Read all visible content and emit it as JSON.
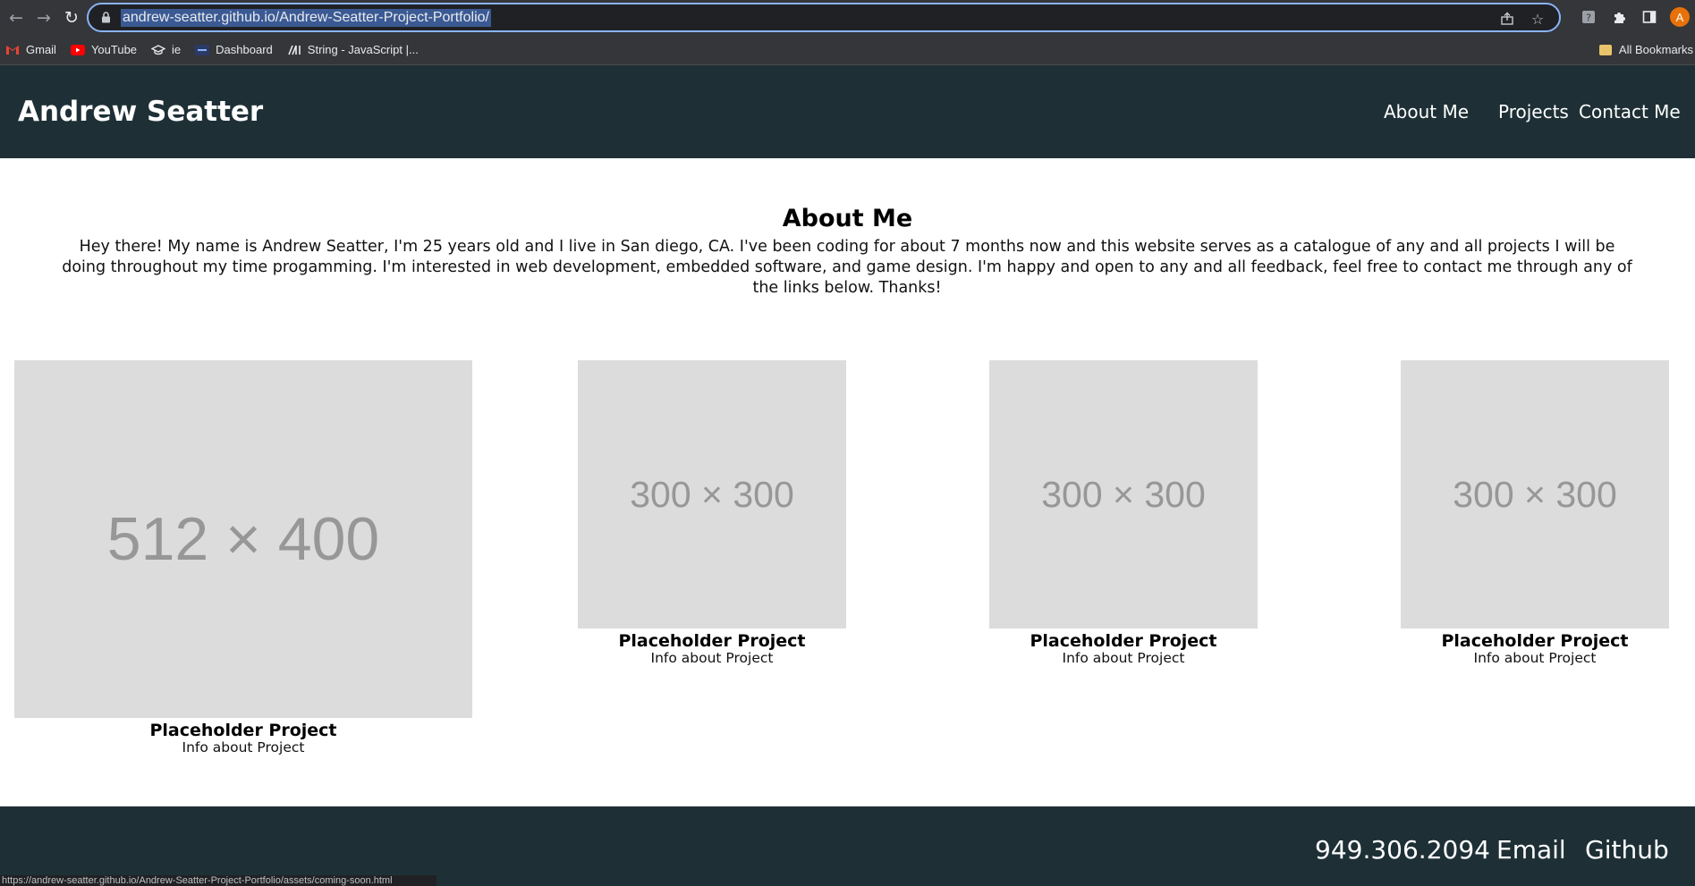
{
  "browser": {
    "url": "andrew-seatter.github.io/Andrew-Seatter-Project-Portfolio/",
    "avatar_letter": "A",
    "bookmarks": [
      "Gmail",
      "YouTube",
      "ie",
      "Dashboard",
      "String - JavaScript |..."
    ],
    "all_bookmarks": "All Bookmarks",
    "status_url": "https://andrew-seatter.github.io/Andrew-Seatter-Project-Portfolio/assets/coming-soon.html"
  },
  "header": {
    "title": "Andrew Seatter",
    "nav": [
      "About Me",
      "Projects",
      "Contact Me"
    ]
  },
  "about": {
    "heading": "About Me",
    "text": "Hey there! My name is Andrew Seatter, I'm 25 years old and I live in San diego, CA. I've been coding for about 7 months now and this website serves as a catalogue of any and all projects I will be doing throughout my time progamming. I'm interested in web development, embedded software, and game design. I'm happy and open to any and all feedback, feel free to contact me through any of the links below. Thanks!"
  },
  "projects": [
    {
      "image_label": "512 × 400",
      "title": "Placeholder Project",
      "info": "Info about Project"
    },
    {
      "image_label": "300 × 300",
      "title": "Placeholder Project",
      "info": "Info about Project"
    },
    {
      "image_label": "300 × 300",
      "title": "Placeholder Project",
      "info": "Info about Project"
    },
    {
      "image_label": "300 × 300",
      "title": "Placeholder Project",
      "info": "Info about Project"
    }
  ],
  "footer": {
    "phone": "949.306.2094",
    "email": "Email",
    "github": "Github"
  },
  "colors": {
    "header_bg": "#1e3036",
    "placeholder_bg": "#dcdcdc",
    "placeholder_text": "#979797"
  }
}
